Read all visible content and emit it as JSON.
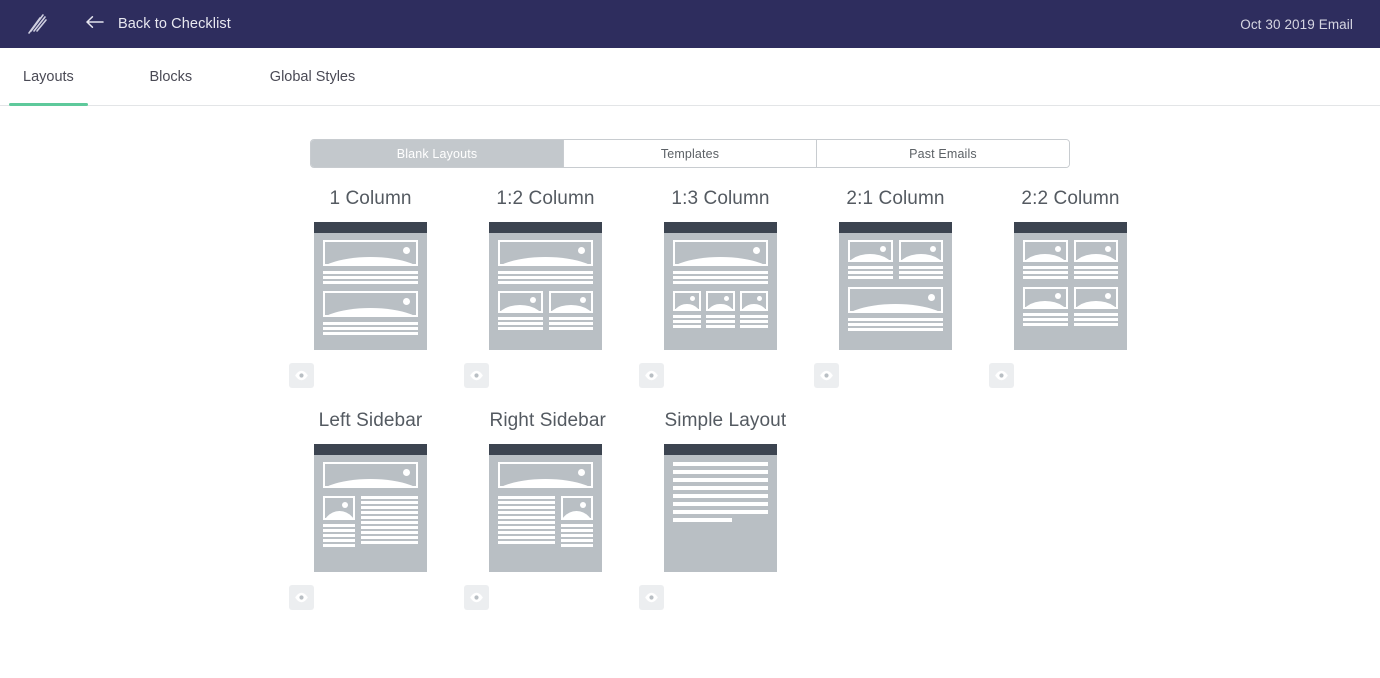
{
  "header": {
    "logo_icon": "feather-logo-icon",
    "back_arrow_icon": "arrow-left-icon",
    "back_label": "Back to Checklist",
    "email_label": "Oct 30 2019 Email",
    "bg_color": "#2e2d5e"
  },
  "tabs": {
    "active_index": 0,
    "accent_color": "#5ec99b",
    "items": [
      {
        "label": "Layouts"
      },
      {
        "label": "Blocks"
      },
      {
        "label": "Global Styles"
      }
    ]
  },
  "segmented_control": {
    "active_index": 0,
    "active_bg": "#c3c8cc",
    "items": [
      {
        "label": "Blank Layouts"
      },
      {
        "label": "Templates"
      },
      {
        "label": "Past Emails"
      }
    ]
  },
  "layouts": {
    "preview_icon": "eye-icon",
    "thumb_header_color": "#3c4450",
    "thumb_body_color": "#b9bfc4",
    "items": [
      {
        "title": "1 Column",
        "kind": "one-column"
      },
      {
        "title": "1:2 Column",
        "kind": "one-two"
      },
      {
        "title": "1:3 Column",
        "kind": "one-three"
      },
      {
        "title": "2:1 Column",
        "kind": "two-one"
      },
      {
        "title": "2:2 Column",
        "kind": "two-two"
      },
      {
        "title": "Left Sidebar",
        "kind": "left-sidebar"
      },
      {
        "title": "Right Sidebar",
        "kind": "right-sidebar"
      },
      {
        "title": "Simple Layout",
        "kind": "simple"
      }
    ]
  }
}
